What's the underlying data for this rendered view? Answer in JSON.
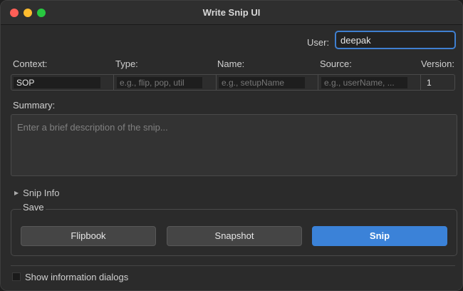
{
  "window": {
    "title": "Write Snip UI"
  },
  "user": {
    "label": "User:",
    "value": "deepak"
  },
  "columns": {
    "context": "Context:",
    "type": "Type:",
    "name": "Name:",
    "source": "Source:",
    "version": "Version:"
  },
  "fields": {
    "context": "SOP",
    "type_placeholder": "e.g., flip, pop, util",
    "name_placeholder": "e.g., setupName",
    "source_placeholder": "e.g., userName, ...",
    "version": "1"
  },
  "summary": {
    "label": "Summary:",
    "placeholder": "Enter a brief description of the snip..."
  },
  "snip_info": {
    "label": "Snip Info"
  },
  "save": {
    "group_label": "Save",
    "flipbook": "Flipbook",
    "snapshot": "Snapshot",
    "snip": "Snip"
  },
  "options": {
    "show_info_dialogs": "Show information dialogs"
  },
  "colors": {
    "accent": "#3b82d8",
    "focus_border": "#3f7fd0"
  }
}
